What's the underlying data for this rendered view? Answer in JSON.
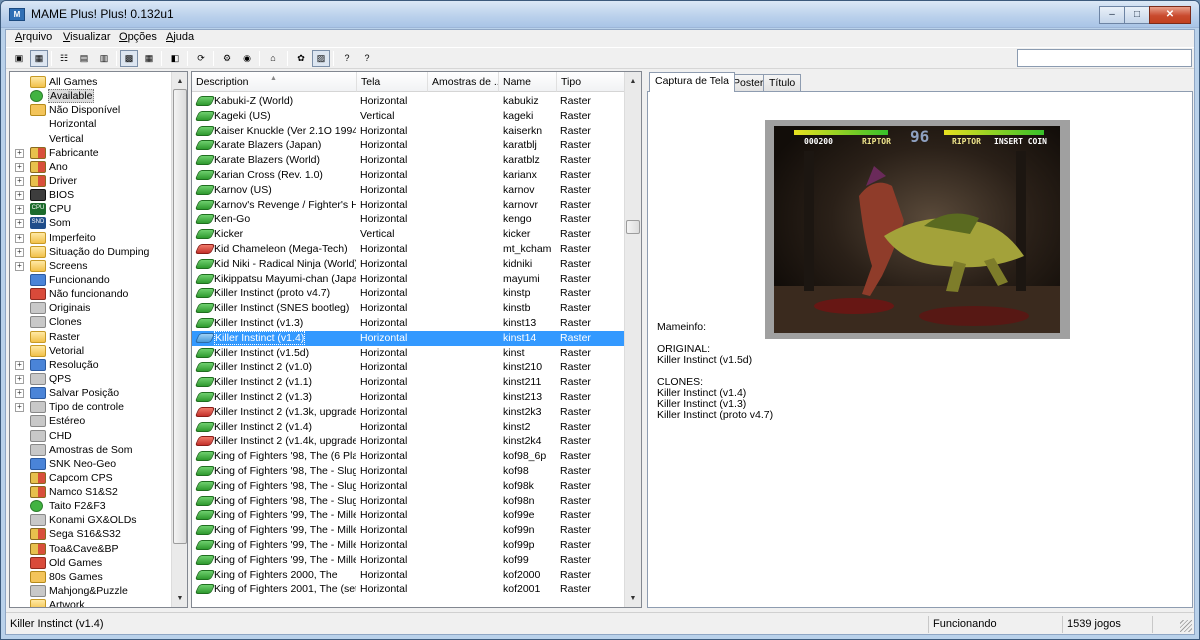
{
  "window": {
    "title": "MAME Plus! Plus! 0.132u1",
    "icon": "mame-app-icon",
    "icon_text": "M"
  },
  "window_buttons": {
    "minimize": "–",
    "maximize": "□",
    "close": "✕"
  },
  "menu": [
    "Arquivo",
    "Visualizar",
    "Opções",
    "Ajuda"
  ],
  "toolbar": {
    "buttons": [
      {
        "name": "view-large-icons-icon",
        "glyph": "▣"
      },
      {
        "name": "view-small-icons-icon",
        "glyph": "▦",
        "pressed": true
      },
      {
        "name": "view-list-icon",
        "glyph": "☷"
      },
      {
        "name": "view-details-icon",
        "glyph": "▤"
      },
      {
        "name": "view-grouped-icon",
        "glyph": "▥"
      },
      {
        "name": "view-report-icon",
        "glyph": "▩",
        "pressed": true
      },
      {
        "name": "view-tiles-icon",
        "glyph": "▦"
      },
      {
        "name": "toggle-folders-icon",
        "glyph": "◧"
      },
      {
        "name": "refresh-icon",
        "glyph": "⟳"
      },
      {
        "name": "options-icon",
        "glyph": "⚙"
      },
      {
        "name": "play-icon",
        "glyph": "◉"
      },
      {
        "name": "home-icon",
        "glyph": "⌂"
      },
      {
        "name": "audit-icon",
        "glyph": "✿"
      },
      {
        "name": "image-toggle-icon",
        "glyph": "▨",
        "pressed": true
      },
      {
        "name": "help-icon",
        "glyph": "?"
      },
      {
        "name": "about-icon",
        "glyph": "?"
      }
    ]
  },
  "folders": [
    {
      "label": "All Games",
      "icon": "folder"
    },
    {
      "label": "Available",
      "icon": "available",
      "selected": true
    },
    {
      "label": "Não Disponível",
      "icon": "unavailable"
    },
    {
      "label": "Horizontal",
      "icon": "none"
    },
    {
      "label": "Vertical",
      "icon": "none"
    },
    {
      "label": "Fabricante",
      "icon": "manufacturer",
      "expandable": true
    },
    {
      "label": "Ano",
      "icon": "year",
      "expandable": true
    },
    {
      "label": "Driver",
      "icon": "driver",
      "expandable": true
    },
    {
      "label": "BIOS",
      "icon": "bios",
      "expandable": true
    },
    {
      "label": "CPU",
      "icon": "cpu",
      "expandable": true
    },
    {
      "label": "Som",
      "icon": "sound",
      "expandable": true
    },
    {
      "label": "Imperfeito",
      "icon": "folder",
      "expandable": true
    },
    {
      "label": "Situação do Dumping",
      "icon": "folder",
      "expandable": true
    },
    {
      "label": "Screens",
      "icon": "folder",
      "expandable": true
    },
    {
      "label": "Funcionando",
      "icon": "working"
    },
    {
      "label": "Não funcionando",
      "icon": "not-working"
    },
    {
      "label": "Originais",
      "icon": "originals"
    },
    {
      "label": "Clones",
      "icon": "clones"
    },
    {
      "label": "Raster",
      "icon": "folder"
    },
    {
      "label": "Vetorial",
      "icon": "folder"
    },
    {
      "label": "Resolução",
      "icon": "resolution",
      "expandable": true
    },
    {
      "label": "QPS",
      "icon": "fps",
      "expandable": true
    },
    {
      "label": "Salvar Posição",
      "icon": "save-state",
      "expandable": true
    },
    {
      "label": "Tipo de controle",
      "icon": "controls",
      "expandable": true
    },
    {
      "label": "Estéreo",
      "icon": "stereo"
    },
    {
      "label": "CHD",
      "icon": "chd"
    },
    {
      "label": "Amostras de Som",
      "icon": "samples"
    },
    {
      "label": "SNK Neo-Geo",
      "icon": "neogeo"
    },
    {
      "label": "Capcom CPS",
      "icon": "capcom"
    },
    {
      "label": "Namco S1&S2",
      "icon": "namco"
    },
    {
      "label": "Taito F2&F3",
      "icon": "taito"
    },
    {
      "label": "Konami GX&OLDs",
      "icon": "konami"
    },
    {
      "label": "Sega S16&S32",
      "icon": "sega"
    },
    {
      "label": "Toa&Cave&BP",
      "icon": "toaplan"
    },
    {
      "label": "Old Games",
      "icon": "old-games"
    },
    {
      "label": "80s Games",
      "icon": "80s-games"
    },
    {
      "label": "Mahjong&Puzzle",
      "icon": "mahjong"
    },
    {
      "label": "Artwork",
      "icon": "folder"
    }
  ],
  "columns": [
    "Description",
    "Tela",
    "Amostras de ...",
    "Name",
    "Tipo"
  ],
  "games": [
    {
      "desc": "Kabuki-Z (World)",
      "screen": "Horizontal",
      "name": "kabukiz",
      "type": "Raster",
      "status": "green"
    },
    {
      "desc": "Kageki (US)",
      "screen": "Vertical",
      "name": "kageki",
      "type": "Raster",
      "status": "green"
    },
    {
      "desc": "Kaiser Knuckle (Ver 2.1O 1994...",
      "screen": "Horizontal",
      "name": "kaiserkn",
      "type": "Raster",
      "status": "green"
    },
    {
      "desc": "Karate Blazers (Japan)",
      "screen": "Horizontal",
      "name": "karatblj",
      "type": "Raster",
      "status": "green"
    },
    {
      "desc": "Karate Blazers (World)",
      "screen": "Horizontal",
      "name": "karatblz",
      "type": "Raster",
      "status": "green"
    },
    {
      "desc": "Karian Cross (Rev. 1.0)",
      "screen": "Horizontal",
      "name": "karianx",
      "type": "Raster",
      "status": "green"
    },
    {
      "desc": "Karnov (US)",
      "screen": "Horizontal",
      "name": "karnov",
      "type": "Raster",
      "status": "green"
    },
    {
      "desc": "Karnov's Revenge / Fighter's H...",
      "screen": "Horizontal",
      "name": "karnovr",
      "type": "Raster",
      "status": "green"
    },
    {
      "desc": "Ken-Go",
      "screen": "Horizontal",
      "name": "kengo",
      "type": "Raster",
      "status": "green"
    },
    {
      "desc": "Kicker",
      "screen": "Vertical",
      "name": "kicker",
      "type": "Raster",
      "status": "green"
    },
    {
      "desc": "Kid Chameleon (Mega-Tech)",
      "screen": "Horizontal",
      "name": "mt_kcham",
      "type": "Raster",
      "status": "red"
    },
    {
      "desc": "Kid Niki - Radical Ninja (World)",
      "screen": "Horizontal",
      "name": "kidniki",
      "type": "Raster",
      "status": "green"
    },
    {
      "desc": "Kikippatsu Mayumi-chan (Japan)",
      "screen": "Horizontal",
      "name": "mayumi",
      "type": "Raster",
      "status": "green"
    },
    {
      "desc": "Killer Instinct (proto v4.7)",
      "screen": "Horizontal",
      "name": "kinstp",
      "type": "Raster",
      "status": "green"
    },
    {
      "desc": "Killer Instinct (SNES bootleg)",
      "screen": "Horizontal",
      "name": "kinstb",
      "type": "Raster",
      "status": "green"
    },
    {
      "desc": "Killer Instinct (v1.3)",
      "screen": "Horizontal",
      "name": "kinst13",
      "type": "Raster",
      "status": "green"
    },
    {
      "desc": "Killer Instinct (v1.4)",
      "screen": "Horizontal",
      "name": "kinst14",
      "type": "Raster",
      "status": "blue",
      "selected": true
    },
    {
      "desc": "Killer Instinct (v1.5d)",
      "screen": "Horizontal",
      "name": "kinst",
      "type": "Raster",
      "status": "green"
    },
    {
      "desc": "Killer Instinct 2 (v1.0)",
      "screen": "Horizontal",
      "name": "kinst210",
      "type": "Raster",
      "status": "green"
    },
    {
      "desc": "Killer Instinct 2 (v1.1)",
      "screen": "Horizontal",
      "name": "kinst211",
      "type": "Raster",
      "status": "green"
    },
    {
      "desc": "Killer Instinct 2 (v1.3)",
      "screen": "Horizontal",
      "name": "kinst213",
      "type": "Raster",
      "status": "green"
    },
    {
      "desc": "Killer Instinct 2 (v1.3k, upgrade ...",
      "screen": "Horizontal",
      "name": "kinst2k3",
      "type": "Raster",
      "status": "red"
    },
    {
      "desc": "Killer Instinct 2 (v1.4)",
      "screen": "Horizontal",
      "name": "kinst2",
      "type": "Raster",
      "status": "green"
    },
    {
      "desc": "Killer Instinct 2 (v1.4k, upgrade ...",
      "screen": "Horizontal",
      "name": "kinst2k4",
      "type": "Raster",
      "status": "red"
    },
    {
      "desc": "King of Fighters '98, The (6 Play...",
      "screen": "Horizontal",
      "name": "kof98_6p",
      "type": "Raster",
      "status": "green"
    },
    {
      "desc": "King of Fighters '98, The - Slugf...",
      "screen": "Horizontal",
      "name": "kof98",
      "type": "Raster",
      "status": "green"
    },
    {
      "desc": "King of Fighters '98, The - Slugf...",
      "screen": "Horizontal",
      "name": "kof98k",
      "type": "Raster",
      "status": "green"
    },
    {
      "desc": "King of Fighters '98, The - Slugf...",
      "screen": "Horizontal",
      "name": "kof98n",
      "type": "Raster",
      "status": "green"
    },
    {
      "desc": "King of Fighters '99, The - Mille...",
      "screen": "Horizontal",
      "name": "kof99e",
      "type": "Raster",
      "status": "green"
    },
    {
      "desc": "King of Fighters '99, The - Mille...",
      "screen": "Horizontal",
      "name": "kof99n",
      "type": "Raster",
      "status": "green"
    },
    {
      "desc": "King of Fighters '99, The - Mille...",
      "screen": "Horizontal",
      "name": "kof99p",
      "type": "Raster",
      "status": "green"
    },
    {
      "desc": "King of Fighters '99, The - Mille...",
      "screen": "Horizontal",
      "name": "kof99",
      "type": "Raster",
      "status": "green"
    },
    {
      "desc": "King of Fighters 2000, The",
      "screen": "Horizontal",
      "name": "kof2000",
      "type": "Raster",
      "status": "green"
    },
    {
      "desc": "King of Fighters 2001, The (set 1)",
      "screen": "Horizontal",
      "name": "kof2001",
      "type": "Raster",
      "status": "green"
    }
  ],
  "tabs": [
    "Captura de Tela",
    "Poster",
    "Título"
  ],
  "screenshot": {
    "hud_score": "000200",
    "hud_p1": "RIPTOR",
    "hud_timer": "96",
    "hud_p2": "RIPTOR",
    "hud_coin": "INSERT COIN"
  },
  "mameinfo": {
    "heading": "Mameinfo:",
    "original_heading": "ORIGINAL:",
    "original": "Killer Instinct (v1.5d)",
    "clones_heading": "CLONES:",
    "clones": [
      "Killer Instinct (v1.4)",
      "Killer Instinct (v1.3)",
      "Killer Instinct (proto v4.7)"
    ]
  },
  "status": {
    "selected": "Killer Instinct (v1.4)",
    "state": "Funcionando",
    "count": "1539 jogos"
  },
  "colors": {
    "selection": "#3399ff",
    "working": "#2f9a2f",
    "broken": "#c4302a"
  }
}
